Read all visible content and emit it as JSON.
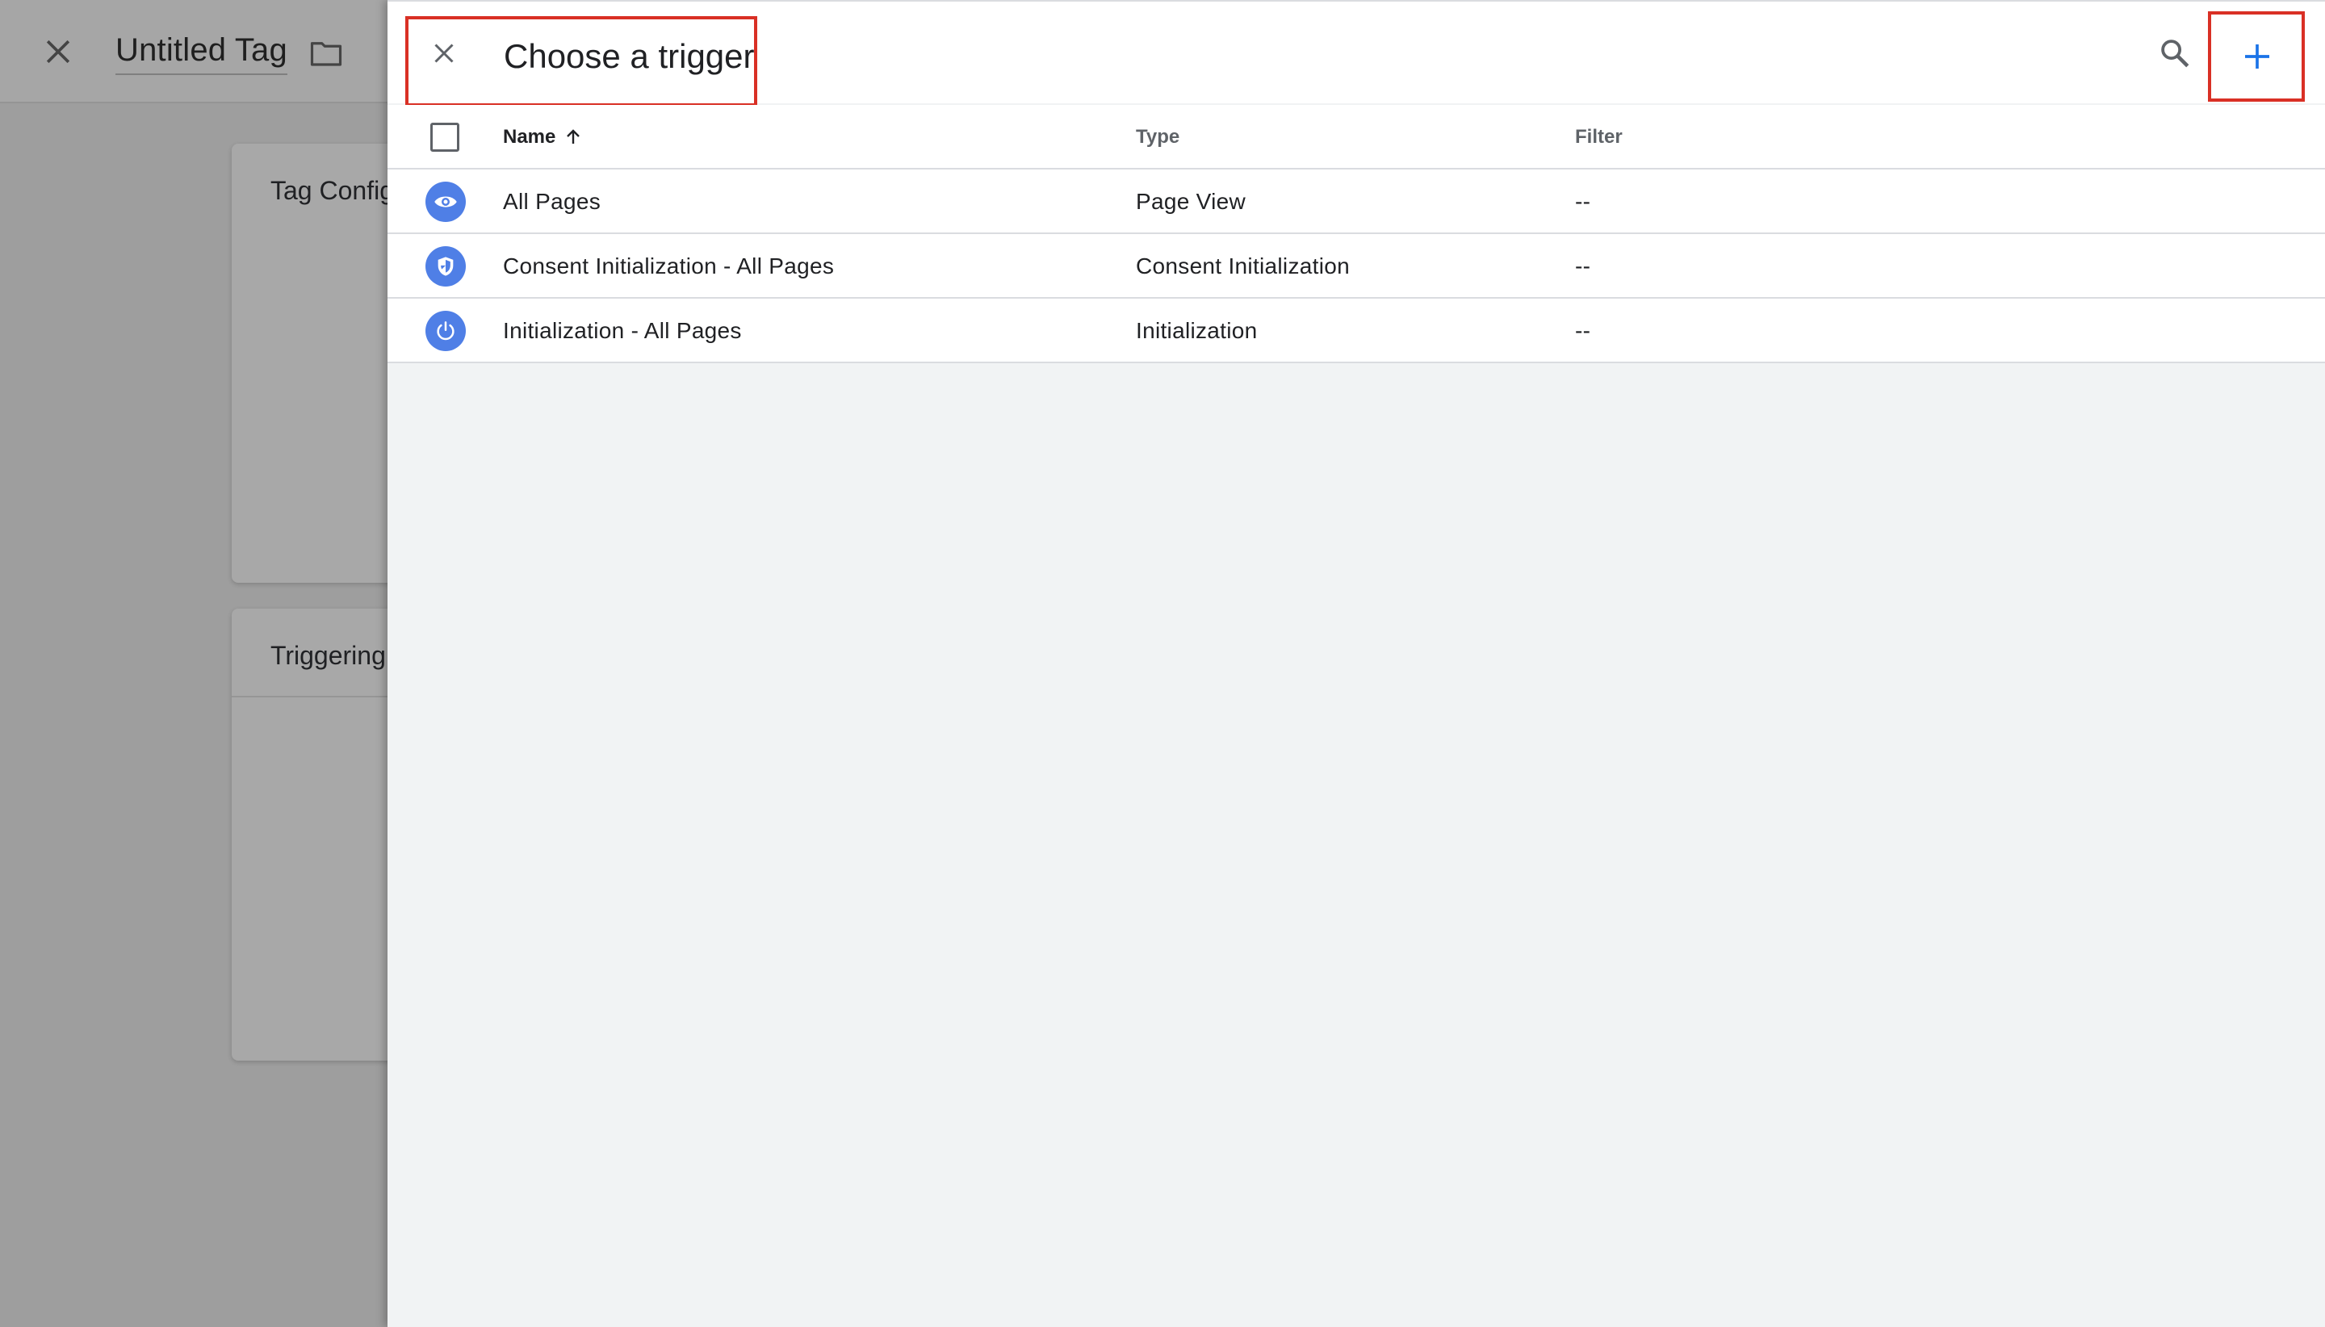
{
  "background_editor": {
    "title": "Untitled Tag",
    "cards": [
      {
        "title": "Tag Configuration"
      },
      {
        "title": "Triggering"
      }
    ]
  },
  "drawer": {
    "title": "Choose a trigger",
    "table": {
      "headers": {
        "name": "Name",
        "type": "Type",
        "filter": "Filter"
      },
      "sort": "ascending",
      "rows": [
        {
          "icon": "eye-icon",
          "name": "All Pages",
          "type": "Page View",
          "filter": "--"
        },
        {
          "icon": "shield-icon",
          "name": "Consent Initialization - All Pages",
          "type": "Consent Initialization",
          "filter": "--"
        },
        {
          "icon": "power-icon",
          "name": "Initialization - All Pages",
          "type": "Initialization",
          "filter": "--"
        }
      ]
    }
  },
  "colors": {
    "accent": "#4f7fe6",
    "highlight": "#d93025",
    "add_icon": "#1a73e8"
  }
}
